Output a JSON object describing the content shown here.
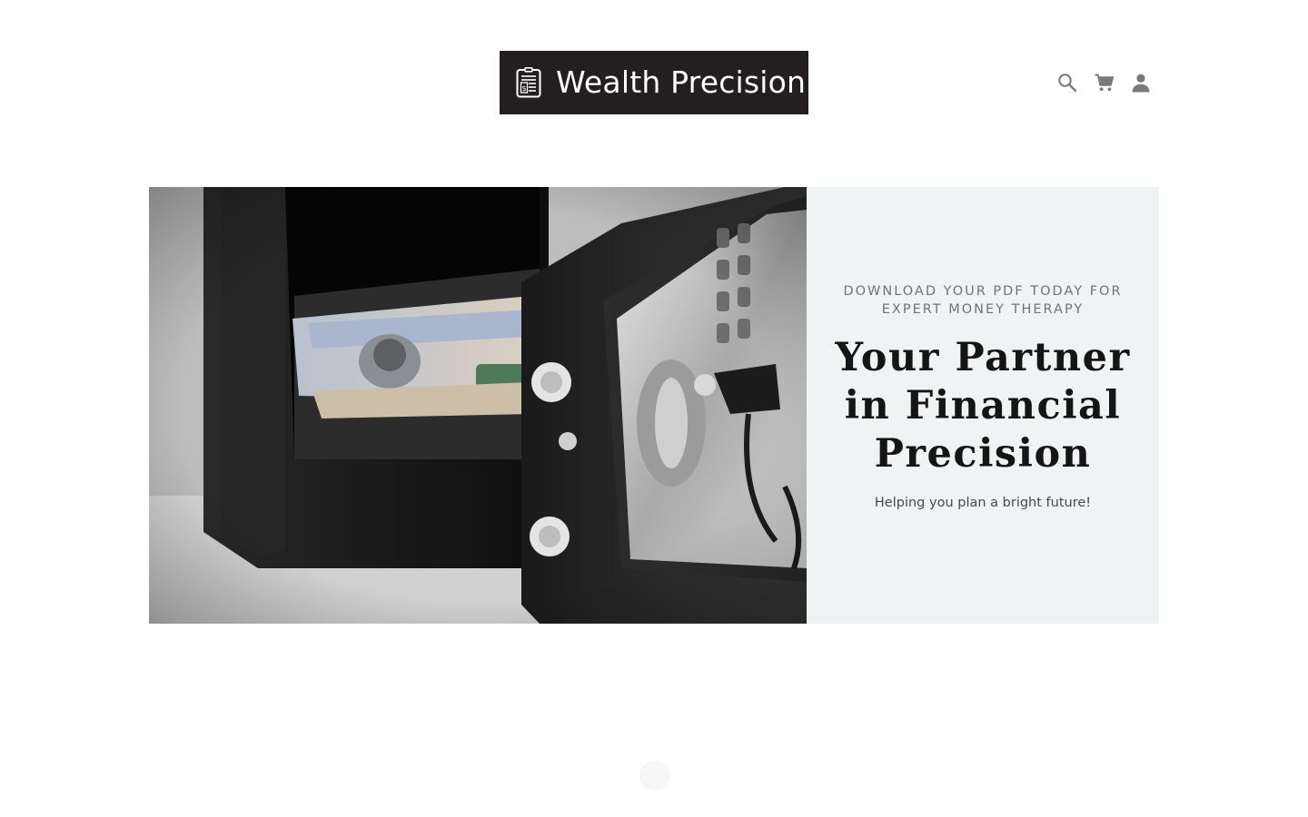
{
  "header": {
    "logo_text": "Wealth Precision",
    "icons": [
      "search-icon",
      "cart-icon",
      "account-icon"
    ]
  },
  "hero": {
    "eyebrow": "DOWNLOAD YOUR PDF TODAY FOR EXPERT MONEY THERAPY",
    "headline": "Your Partner in Financial Precision",
    "subtext": "Helping you plan a bright future!"
  },
  "colors": {
    "logo_bg": "#231f20",
    "panel_bg": "#eff3f4",
    "icon": "#7a7a7a",
    "headline": "#151515"
  }
}
